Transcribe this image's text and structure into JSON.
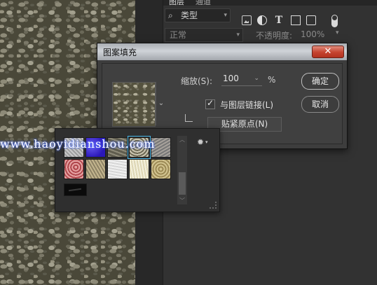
{
  "panel": {
    "tabs": [
      "图层",
      "通道"
    ],
    "kind_filter": {
      "label": "类型"
    },
    "blend": {
      "mode": "正常",
      "opacity_label": "不透明度:",
      "opacity_value": "100%"
    }
  },
  "dialog": {
    "title": "图案填充",
    "close_glyph": "✕",
    "scale_label": "缩放(S):",
    "scale_value": "100",
    "scale_unit": "%",
    "link_label": "与图层链接(L)",
    "link_checked": true,
    "snap_button": "贴紧原点(N)",
    "ok_button": "确定",
    "cancel_button": "取消"
  },
  "picker": {
    "selected_index": 3,
    "swatch_count": 11
  },
  "watermark": "www.haoyidianshou.com",
  "colors": {
    "panel_bg": "#323232",
    "dialog_bg": "#3d3d3d",
    "close_red": "#c5432f",
    "selection_blue": "#49b6e6"
  }
}
